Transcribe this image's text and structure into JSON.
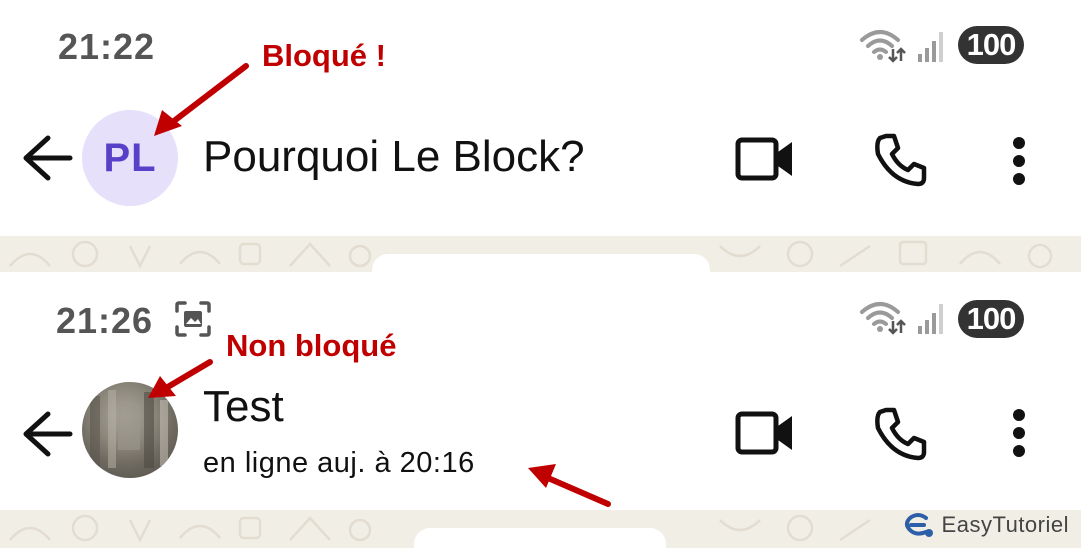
{
  "top_screen": {
    "time": "21:22",
    "battery": "100",
    "avatar_initials": "PL",
    "contact_name": "Pourquoi Le Block?",
    "annotation": "Bloqué !"
  },
  "bottom_screen": {
    "time": "21:26",
    "battery": "100",
    "contact_name": "Test",
    "contact_status": "en ligne auj. à 20:16",
    "annotation": "Non bloqué"
  },
  "watermark": {
    "text": "EasyTutoriel"
  },
  "icons": {
    "back": "arrow-left-icon",
    "video": "video-camera-icon",
    "call": "phone-icon",
    "menu": "more-vertical-icon",
    "wifi": "wifi-icon",
    "signal": "signal-icon",
    "screenshot": "screenshot-icon"
  },
  "colors": {
    "annotation": "#c00000",
    "avatar_bg": "#e6e0fb",
    "avatar_text": "#5940c9",
    "chat_background": "#f1eee6"
  }
}
